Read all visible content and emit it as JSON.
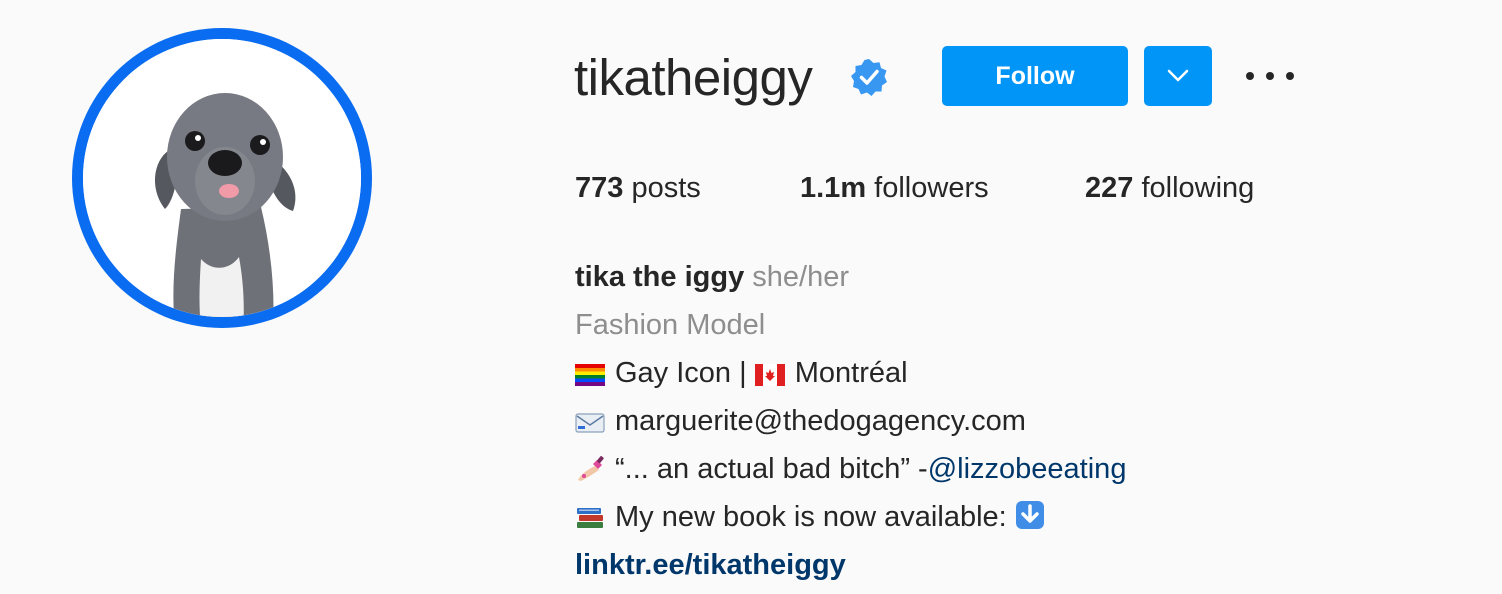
{
  "profile": {
    "username": "tikatheiggy",
    "verified": true,
    "avatar_ring_color": "#0a6cf0"
  },
  "actions": {
    "follow_label": "Follow",
    "dropdown_icon": "chevron-down-icon",
    "more_icon": "more-options-icon",
    "accent_color": "#0095f6"
  },
  "stats": {
    "posts_count": "773",
    "posts_label": "posts",
    "followers_count": "1.1m",
    "followers_label": "followers",
    "following_count": "227",
    "following_label": "following"
  },
  "bio": {
    "full_name": "tika the iggy",
    "pronouns": "she/her",
    "category": "Fashion Model",
    "line3_a": "Gay Icon | ",
    "line3_b": "Montréal",
    "email": "marguerite@thedogagency.com",
    "quote_text": "“... an actual bad bitch” -",
    "quote_mention": "@lizzobeeating",
    "book_text": "My new book is now available: ",
    "website": "linktr.ee/tikatheiggy",
    "emoji_icons": [
      "rainbow-flag-icon",
      "canada-flag-icon",
      "envelope-icon",
      "nail-polish-icon",
      "books-icon",
      "down-arrow-icon"
    ]
  }
}
